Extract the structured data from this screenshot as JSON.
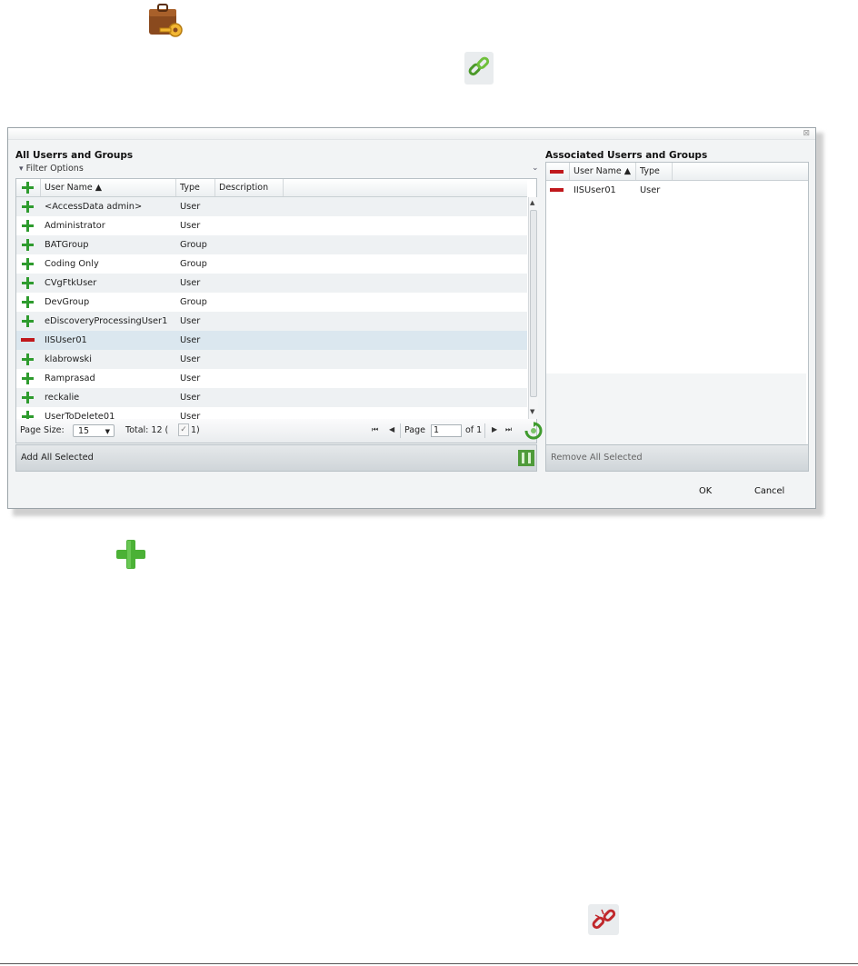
{
  "left_panel": {
    "title": "All Userrs and Groups",
    "filter_label": "Filter Options",
    "columns": {
      "user_name": "User Name ▲",
      "type": "Type",
      "description": "Description"
    },
    "rows": [
      {
        "icon": "plus-icon",
        "name": "<AccessData admin>",
        "type": "User"
      },
      {
        "icon": "plus-icon",
        "name": "Administrator",
        "type": "User"
      },
      {
        "icon": "plus-icon",
        "name": "BATGroup",
        "type": "Group"
      },
      {
        "icon": "plus-icon",
        "name": "Coding Only",
        "type": "Group"
      },
      {
        "icon": "plus-icon",
        "name": "CVgFtkUser",
        "type": "User"
      },
      {
        "icon": "plus-icon",
        "name": "DevGroup",
        "type": "Group"
      },
      {
        "icon": "plus-icon",
        "name": "eDiscoveryProcessingUser1",
        "type": "User"
      },
      {
        "icon": "minus-icon",
        "name": "IISUser01",
        "type": "User"
      },
      {
        "icon": "plus-icon",
        "name": "klabrowski",
        "type": "User"
      },
      {
        "icon": "plus-icon",
        "name": "Ramprasad",
        "type": "User"
      },
      {
        "icon": "plus-icon",
        "name": "reckalie",
        "type": "User"
      },
      {
        "icon": "plus-icon",
        "name": "UserToDelete01",
        "type": "User"
      }
    ],
    "pager": {
      "page_size_label": "Page Size:",
      "page_size_value": "15",
      "total_label": "Total: 12 (",
      "checked_count": "1)",
      "page_label": "Page",
      "page_value": "1",
      "of_label": "of 1"
    },
    "add_all_label": "Add All Selected"
  },
  "right_panel": {
    "title": "Associated Userrs and Groups",
    "columns": {
      "user_name": "User Name ▲",
      "type": "Type"
    },
    "rows": [
      {
        "icon": "minus-icon",
        "name": "IISUser01",
        "type": "User"
      }
    ],
    "remove_all_label": "Remove All Selected"
  },
  "buttons": {
    "ok": "OK",
    "cancel": "Cancel"
  },
  "dialog_close_glyph": "⊠",
  "icons": [
    "briefcase-key-icon",
    "link-icon",
    "plus-icon",
    "unlink-icon",
    "refresh-icon",
    "pause-icon"
  ],
  "colors": {
    "plus": "#2e9b2e",
    "minus": "#c0181c",
    "selected_row": "#dbe7ef"
  }
}
